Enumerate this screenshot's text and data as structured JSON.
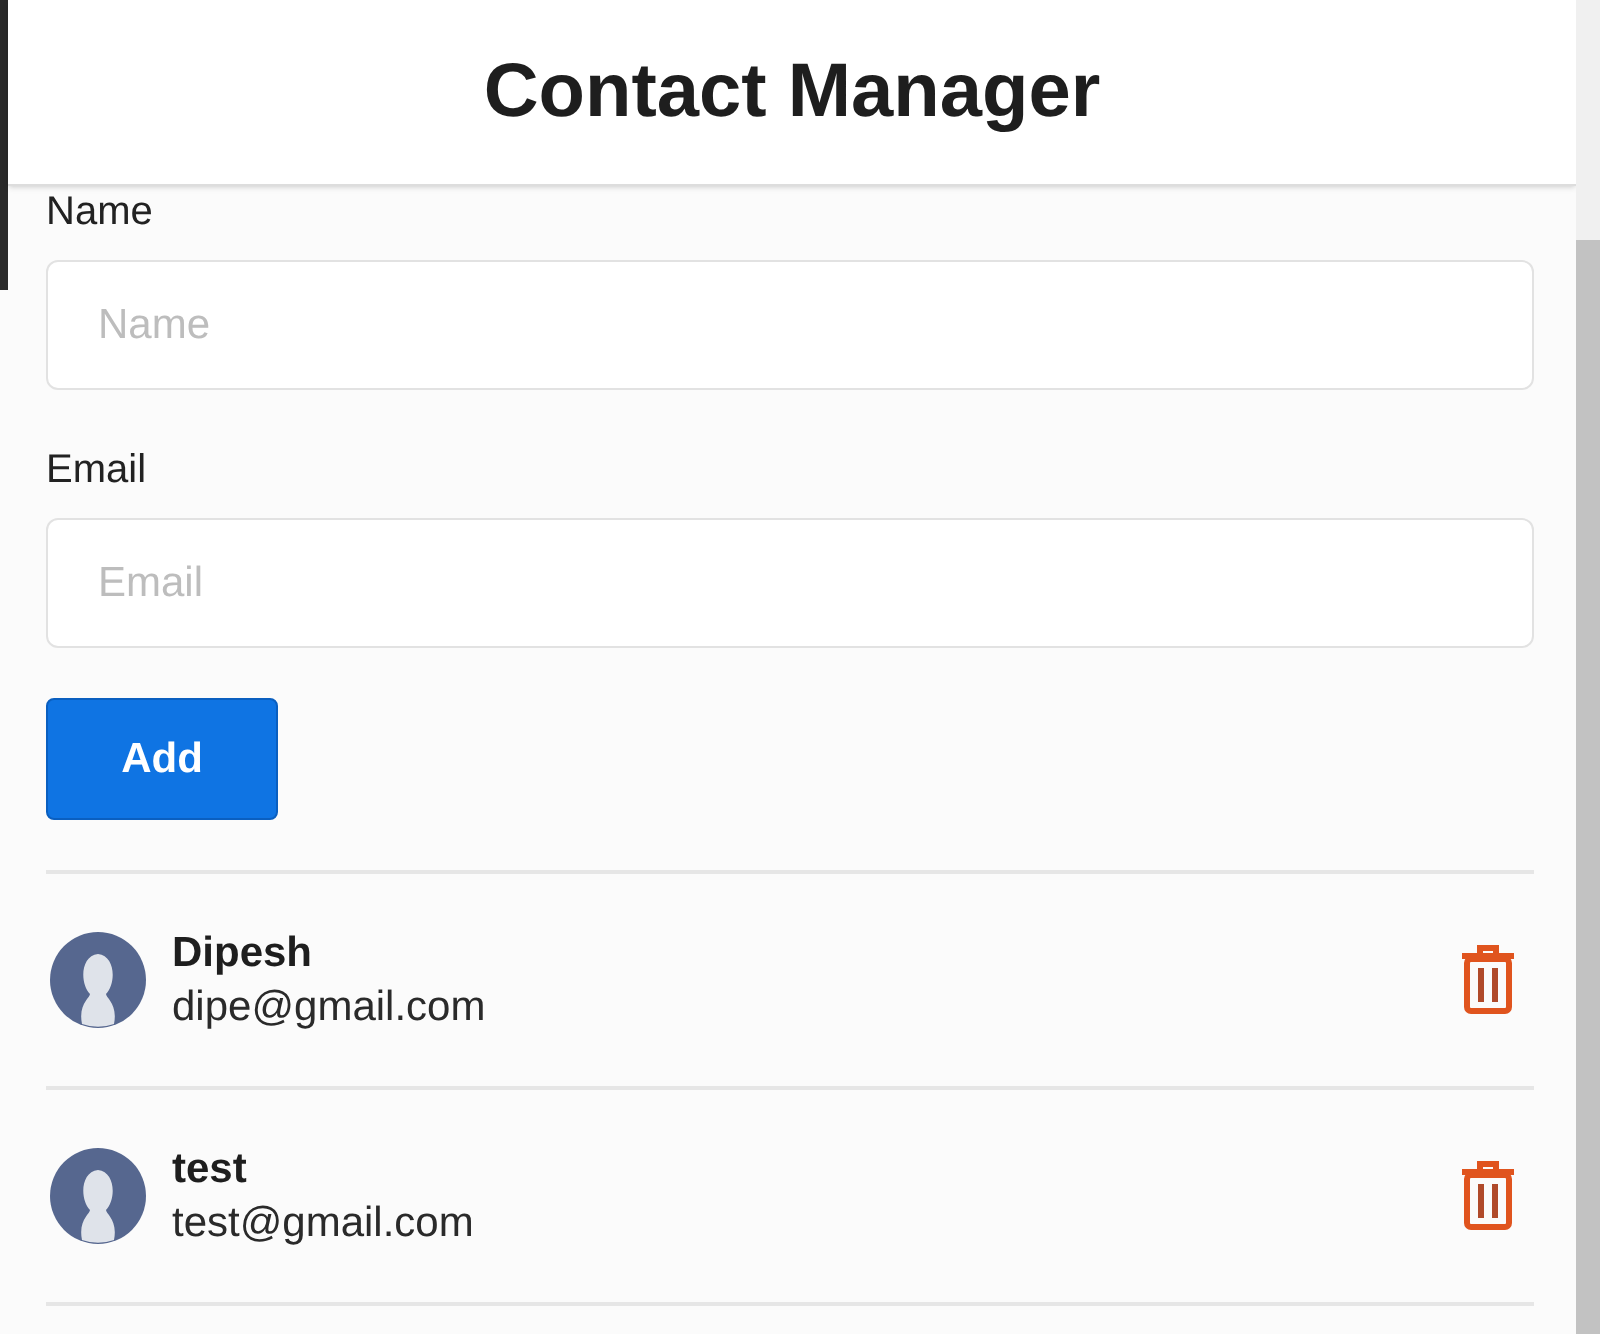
{
  "header": {
    "title": "Contact Manager"
  },
  "form": {
    "fields": [
      {
        "label": "Name",
        "placeholder": "Name"
      },
      {
        "label": "Email",
        "placeholder": "Email"
      }
    ],
    "button": "Add"
  },
  "contacts": [
    {
      "name": "Dipesh",
      "email": "dipe@gmail.com"
    },
    {
      "name": "test",
      "email": "test@gmail.com"
    }
  ]
}
